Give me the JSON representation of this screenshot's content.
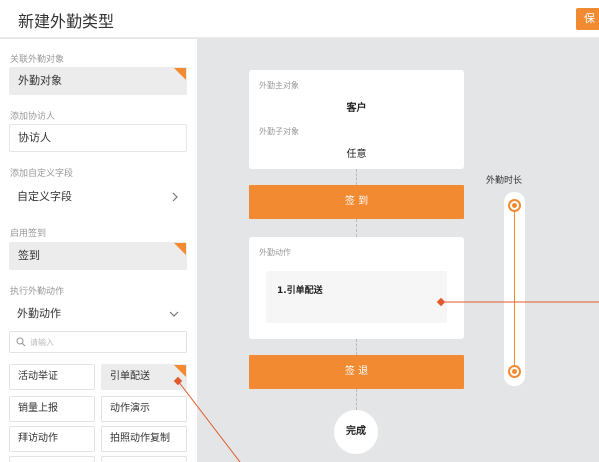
{
  "header": {
    "title": "新建外勤类型",
    "save_label": "保"
  },
  "sidebar": {
    "related_label": "关联外勤对象",
    "related_value": "外勤对象",
    "visitor_label": "添加协访人",
    "visitor_value": "协访人",
    "custom_label": "添加自定义字段",
    "custom_value": "自定义字段",
    "checkin_label": "启用签到",
    "checkin_value": "签到",
    "action_label": "执行外勤动作",
    "action_value": "外勤动作",
    "search_placeholder": "请输入",
    "chips": [
      "活动举证",
      "引单配送",
      "销量上报",
      "动作演示",
      "拜访动作",
      "拍照动作复制"
    ]
  },
  "canvas": {
    "main_object_label": "外勤主对象",
    "main_object_value": "客户",
    "sub_object_label": "外勤子对象",
    "sub_object_value": "任意",
    "checkin_bar": "签 到",
    "action_label": "外勤动作",
    "action_item": "1.引单配送",
    "checkout_bar": "签 退",
    "finish": "完成",
    "duration_label": "外勤时长"
  },
  "colors": {
    "accent": "#f28a32"
  }
}
